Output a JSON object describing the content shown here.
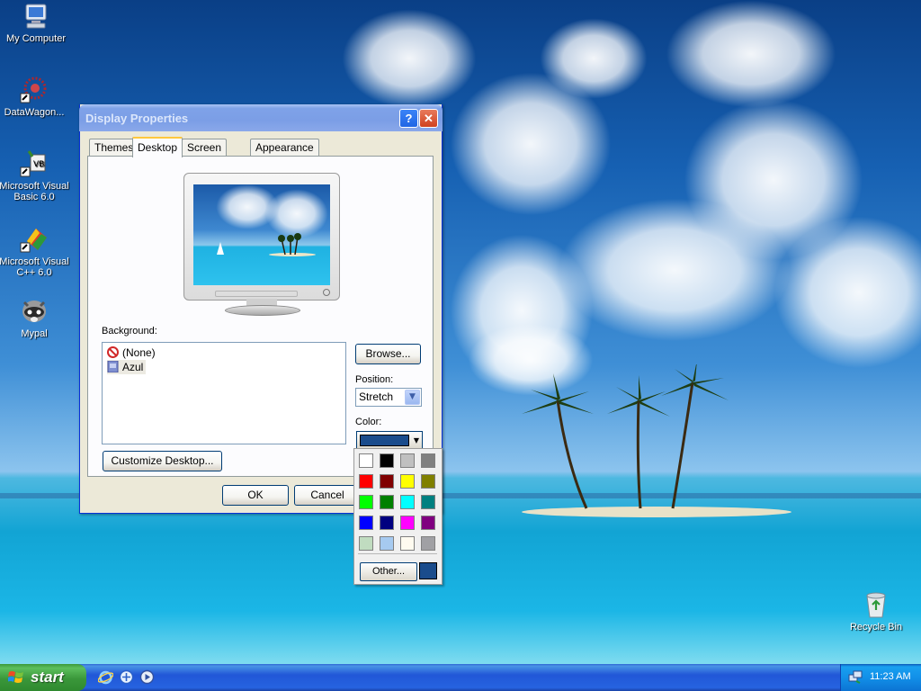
{
  "desktop": {
    "icons": [
      {
        "label": "My Computer"
      },
      {
        "label": "DataWagon..."
      },
      {
        "label": "Microsoft Visual Basic 6.0"
      },
      {
        "label": "Microsoft Visual C++ 6.0"
      },
      {
        "label": "Mypal"
      },
      {
        "label": "Recycle Bin"
      }
    ]
  },
  "window": {
    "title": "Display Properties",
    "help_label": "?",
    "close_label": "✕",
    "tabs": [
      "Themes",
      "Desktop",
      "Screen Saver",
      "Appearance"
    ],
    "active_tab": "Desktop",
    "background_label": "Background:",
    "background_items": [
      "(None)",
      "Azul"
    ],
    "selected_background": "Azul",
    "browse_label": "Browse...",
    "position_label": "Position:",
    "position_value": "Stretch",
    "color_label": "Color:",
    "current_color": "#1a4c8c",
    "customize_label": "Customize Desktop...",
    "ok_label": "OK",
    "cancel_label": "Cancel"
  },
  "color_popup": {
    "swatches": [
      "#ffffff",
      "#000000",
      "#c0c0c0",
      "#808080",
      "#ff0000",
      "#800000",
      "#ffff00",
      "#808000",
      "#00ff00",
      "#008000",
      "#00ffff",
      "#008080",
      "#0000ff",
      "#000080",
      "#ff00ff",
      "#800080",
      "#c0dcc0",
      "#a6caf0",
      "#fffbf0",
      "#a0a0a4"
    ],
    "other_label": "Other...",
    "current_color": "#1a4c8c"
  },
  "taskbar": {
    "start_label": "start",
    "clock": "11:23 AM"
  }
}
